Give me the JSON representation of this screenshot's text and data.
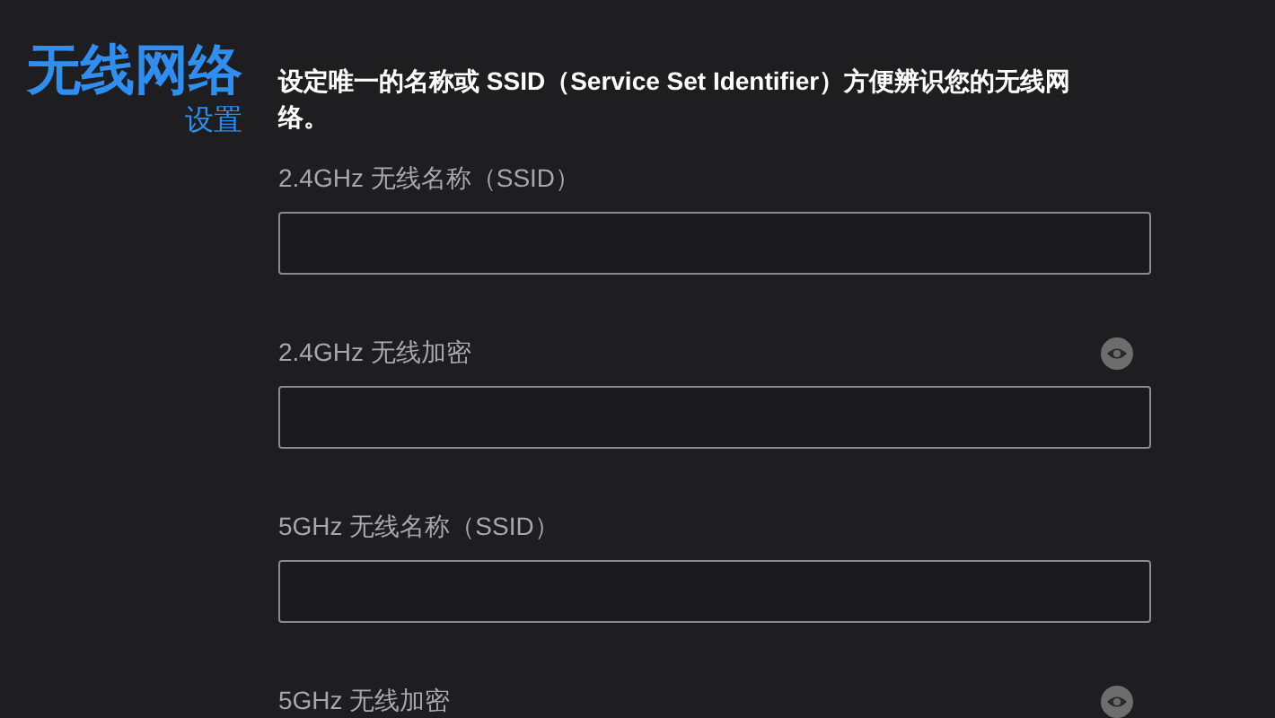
{
  "heading": {
    "title": "无线网络",
    "subtitle": "设置"
  },
  "description": "设定唯一的名称或 SSID（Service Set Identifier）方便辨识您的无线网络。",
  "fields": [
    {
      "label": "2.4GHz 无线名称（SSID）",
      "kind": "text"
    },
    {
      "label": "2.4GHz 无线加密",
      "kind": "password"
    },
    {
      "label": "5GHz 无线名称（SSID）",
      "kind": "text"
    },
    {
      "label": "5GHz 无线加密",
      "kind": "password"
    }
  ]
}
